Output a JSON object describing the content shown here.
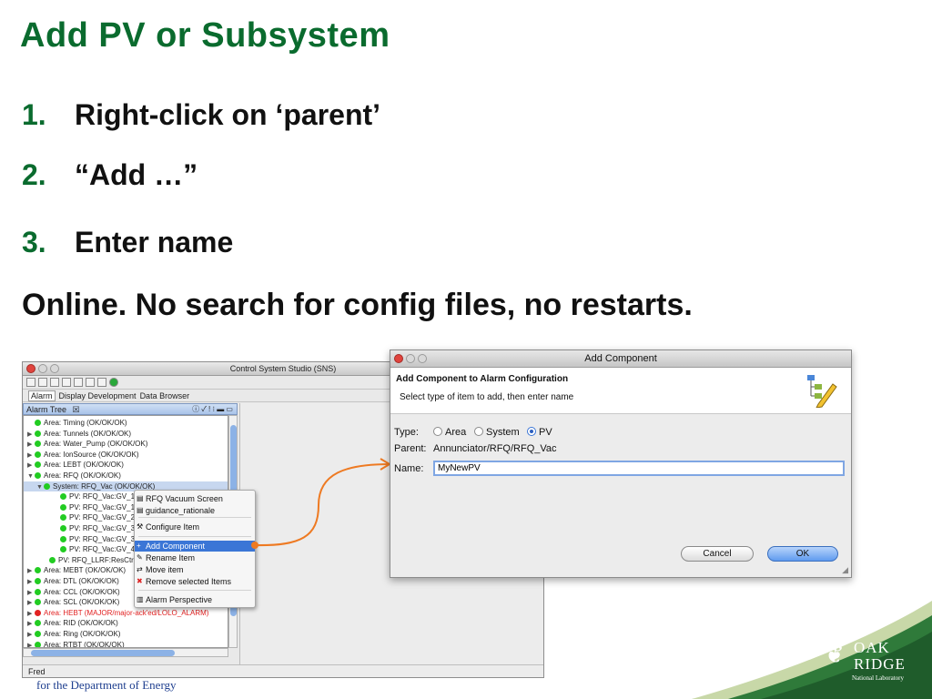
{
  "slide": {
    "title": "Add PV or Subsystem",
    "steps": [
      {
        "num": "1.",
        "text": "Right-click on ‘parent’"
      },
      {
        "num": "2.",
        "text": "“Add …”"
      },
      {
        "num": "3.",
        "text": "Enter name"
      }
    ],
    "note": "Online. No search for config files, no restarts.",
    "footer": "for the Department of Energy",
    "logo": {
      "line1": "OAK",
      "line2": "RIDGE",
      "line3": "National Laboratory"
    },
    "accent_color": "#0a6b2e"
  },
  "css_window": {
    "title": "Control System Studio (SNS)",
    "perspectives": [
      "Alarm",
      "Display Development",
      "Data Browser"
    ],
    "view_tab": "Alarm Tree",
    "status_user": "Fred",
    "tree": [
      {
        "expander": "",
        "color": "green",
        "label": "Area: Timing (OK/OK/OK)"
      },
      {
        "expander": "▶",
        "color": "green",
        "label": "Area: Tunnels (OK/OK/OK)"
      },
      {
        "expander": "▶",
        "color": "green",
        "label": "Area: Water_Pump (OK/OK/OK)"
      },
      {
        "expander": "▶",
        "color": "green",
        "label": "Area: IonSource (OK/OK/OK)"
      },
      {
        "expander": "▶",
        "color": "green",
        "label": "Area: LEBT (OK/OK/OK)"
      },
      {
        "expander": "▼",
        "color": "green",
        "label": "Area: RFQ (OK/OK/OK)"
      },
      {
        "expander": "▼",
        "color": "green",
        "label": "System: RFQ_Vac (OK/OK/OK)"
      },
      {
        "expander": "",
        "color": "green",
        "label": "PV: RFQ_Vac:GV_1A"
      },
      {
        "expander": "",
        "color": "green",
        "label": "PV: RFQ_Vac:GV_1B"
      },
      {
        "expander": "",
        "color": "green",
        "label": "PV: RFQ_Vac:GV_2:"
      },
      {
        "expander": "",
        "color": "green",
        "label": "PV: RFQ_Vac:GV_3A"
      },
      {
        "expander": "",
        "color": "green",
        "label": "PV: RFQ_Vac:GV_3B"
      },
      {
        "expander": "",
        "color": "green",
        "label": "PV: RFQ_Vac:GV_4:"
      },
      {
        "expander": "",
        "color": "green",
        "label": "PV: RFQ_LLRF:ResCtrl1:R"
      },
      {
        "expander": "▶",
        "color": "green",
        "label": "Area: MEBT (OK/OK/OK)"
      },
      {
        "expander": "▶",
        "color": "green",
        "label": "Area: DTL (OK/OK/OK)"
      },
      {
        "expander": "▶",
        "color": "green",
        "label": "Area: CCL (OK/OK/OK)"
      },
      {
        "expander": "▶",
        "color": "green",
        "label": "Area: SCL (OK/OK/OK)"
      },
      {
        "expander": "▶",
        "color": "red",
        "label": "Area: HEBT (MAJOR/major-ack'ed/LOLO_ALARM)"
      },
      {
        "expander": "▶",
        "color": "green",
        "label": "Area: RID (OK/OK/OK)"
      },
      {
        "expander": "▶",
        "color": "green",
        "label": "Area: Ring (OK/OK/OK)"
      },
      {
        "expander": "▶",
        "color": "green",
        "label": "Area: RTBT (OK/OK/OK)"
      }
    ]
  },
  "context_menu": {
    "items": [
      {
        "label": "RFQ Vacuum Screen",
        "icon": "display-icon"
      },
      {
        "label": "guidance_rationale",
        "icon": "display-icon"
      },
      {
        "label": "Configure Item",
        "icon": "wrench-icon"
      },
      {
        "label": "Add Component",
        "icon": "plus-icon",
        "highlighted": true
      },
      {
        "label": "Rename Item",
        "icon": "rename-icon"
      },
      {
        "label": "Move item",
        "icon": "move-icon"
      },
      {
        "label": "Remove selected Items",
        "icon": "delete-icon"
      },
      {
        "label": "Alarm Perspective",
        "icon": "perspective-icon"
      }
    ]
  },
  "dialog": {
    "title": "Add Component",
    "header_title": "Add Component to Alarm Configuration",
    "header_text": "Select type of item to add, then enter name",
    "type_label": "Type:",
    "type_options": [
      "Area",
      "System",
      "PV"
    ],
    "type_selected": "PV",
    "parent_label": "Parent:",
    "parent_value": "Annunciator/RFQ/RFQ_Vac",
    "name_label": "Name:",
    "name_value": "MyNewPV",
    "cancel_label": "Cancel",
    "ok_label": "OK"
  }
}
